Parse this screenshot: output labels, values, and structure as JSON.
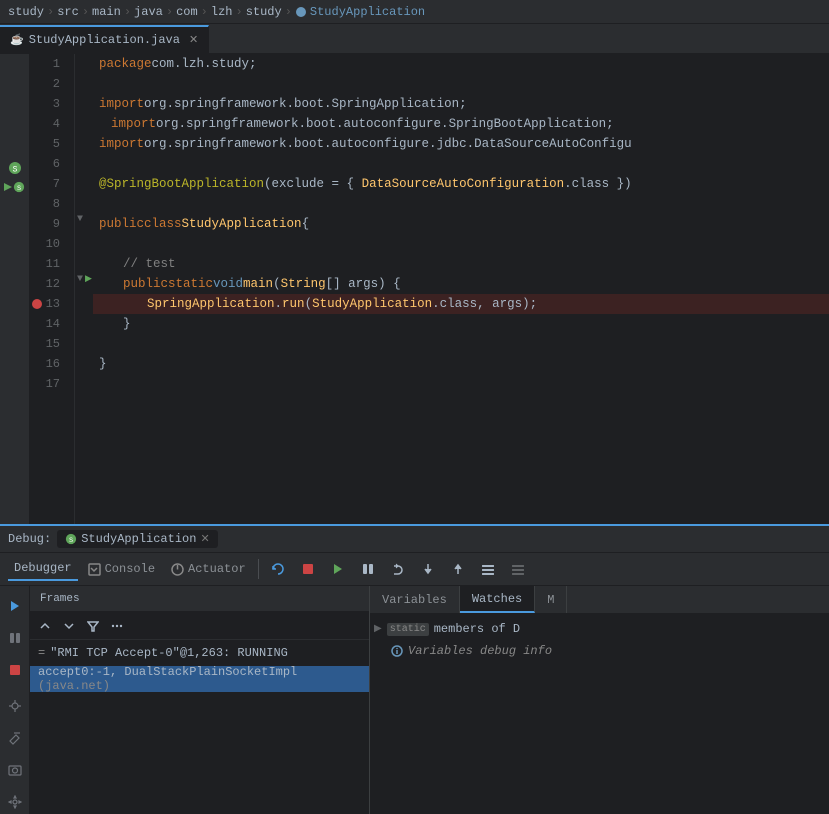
{
  "breadcrumb": {
    "items": [
      "study",
      "src",
      "main",
      "java",
      "com",
      "lzh",
      "study",
      "StudyApplication"
    ]
  },
  "tabs": [
    {
      "label": "StudyApplication.java",
      "active": true
    }
  ],
  "code": {
    "lines": [
      {
        "num": 1,
        "indent": "",
        "content": "package com.lzh.study;"
      },
      {
        "num": 2,
        "indent": "",
        "content": ""
      },
      {
        "num": 3,
        "indent": "",
        "content": "import org.springframework.boot.SpringApplication;"
      },
      {
        "num": 4,
        "indent": "  ",
        "content": "import org.springframework.boot.autoconfigure.SpringBootApplication;"
      },
      {
        "num": 5,
        "indent": "",
        "content": "import org.springframework.boot.autoconfigure.jdbc.DataSourceAutoConfigu"
      },
      {
        "num": 6,
        "indent": "",
        "content": ""
      },
      {
        "num": 7,
        "indent": "",
        "content": "@SpringBootApplication(exclude = { DataSourceAutoConfiguration.class })"
      },
      {
        "num": 8,
        "indent": "",
        "content": ""
      },
      {
        "num": 9,
        "indent": "",
        "content": "public class StudyApplication {"
      },
      {
        "num": 10,
        "indent": "",
        "content": ""
      },
      {
        "num": 11,
        "indent": "    ",
        "content": "// test"
      },
      {
        "num": 12,
        "indent": "    ",
        "content": "public static void main(String[] args) {"
      },
      {
        "num": 13,
        "indent": "        ",
        "content": "SpringApplication.run(StudyApplication.class, args);"
      },
      {
        "num": 14,
        "indent": "    ",
        "content": "}"
      },
      {
        "num": 15,
        "indent": "",
        "content": ""
      },
      {
        "num": 16,
        "indent": "",
        "content": "}"
      },
      {
        "num": 17,
        "indent": "",
        "content": ""
      }
    ]
  },
  "debug": {
    "title": "StudyApplication",
    "toolbar_tabs": [
      "Debugger",
      "Console",
      "Actuator"
    ],
    "toolbar_buttons": [
      "rerun",
      "stop",
      "resume",
      "pause",
      "step-over",
      "step-into",
      "step-out",
      "frames",
      "mute"
    ],
    "frames_header": "Frames",
    "frames": [
      {
        "label": "\"RMI TCP Accept-0\"@1,263: RUNNING",
        "selected": false,
        "icon": "thread"
      },
      {
        "label": "accept0:-1, DualStackPlainSocketImpl (java.net)",
        "selected": true
      }
    ],
    "variables_tabs": [
      "Variables",
      "Watches",
      "M"
    ],
    "variables": [
      {
        "type": "static",
        "label": "static members of D"
      },
      {
        "type": "info",
        "label": "Variables debug info"
      }
    ]
  }
}
